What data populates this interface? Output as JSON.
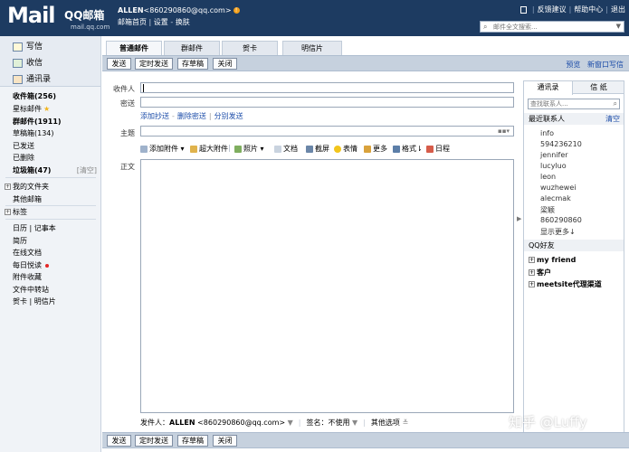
{
  "header": {
    "logo_text": "Mail",
    "logo_cn": "QQ邮箱",
    "logo_domain": "mail.qq.com",
    "user_name": "ALLEN",
    "user_email": "<860290860@qq.com>",
    "links": [
      "邮箱首页",
      "设置",
      "换肤"
    ],
    "top_right": [
      "反馈建议",
      "帮助中心",
      "退出"
    ],
    "search_placeholder": "邮件全文搜索..."
  },
  "sidebar": {
    "compose": "写信",
    "receive": "收信",
    "contacts": "通讯录",
    "folders": [
      {
        "label": "收件箱",
        "count": "(256)",
        "bold": true
      },
      {
        "label": "星标邮件",
        "count": "",
        "bold": false
      },
      {
        "label": "群邮件",
        "count": "(1911)",
        "bold": true
      },
      {
        "label": "草稿箱",
        "count": "(134)",
        "bold": false
      },
      {
        "label": "已发送",
        "count": "",
        "bold": false
      },
      {
        "label": "已删除",
        "count": "",
        "bold": false
      },
      {
        "label": "垃圾箱",
        "count": "(47)",
        "bold": true
      }
    ],
    "clear": "[清空]",
    "my_folders": "我的文件夹",
    "other_mailbox": "其他邮箱",
    "tags": "标签",
    "calendar": "日历",
    "notebook": "记事本",
    "resume": "简历",
    "online_doc": "在线文档",
    "daily_read": "每日悦读",
    "attachments": "附件收藏",
    "file_transfer": "文件中转站",
    "greeting_card": "贺卡",
    "postcard": "明信片"
  },
  "tabs": [
    "普通邮件",
    "群邮件",
    "贺卡",
    "明信片"
  ],
  "toolbar": {
    "send": "发送",
    "schedule": "定时发送",
    "save_draft": "存草稿",
    "close": "关闭",
    "preview": "预览",
    "new_window": "新窗口写信"
  },
  "form": {
    "to_label": "收件人",
    "cc_label": "密送",
    "add_cc": "添加抄送",
    "del_bcc": "删除密送",
    "separate_send": "分别发送",
    "subject_label": "主题",
    "body_label": "正文",
    "format_items": [
      "添加附件",
      "超大附件",
      "照片",
      "文档",
      "截屏",
      "表情",
      "更多",
      "格式",
      "日程"
    ],
    "sender_label": "发件人：",
    "sender_name": "ALLEN",
    "sender_email": "<860290860@qq.com>",
    "signature": "签名：不使用",
    "other_options": "其他选项"
  },
  "rpanel": {
    "tabs": [
      "通讯录",
      "信 纸"
    ],
    "search_placeholder": "查找联系人...",
    "recent_header": "最近联系人",
    "clear": "清空",
    "contacts": [
      "info",
      "594236210",
      "jennifer",
      "lucyluo",
      "leon",
      "wuzhewei",
      "alecmak",
      "梁颖",
      "860290860"
    ],
    "show_more": "显示更多↓",
    "qq_friends": "QQ好友",
    "groups": [
      "my friend",
      "客户",
      "meetsite代理渠道"
    ]
  },
  "watermark": "知乎 @Luffy"
}
